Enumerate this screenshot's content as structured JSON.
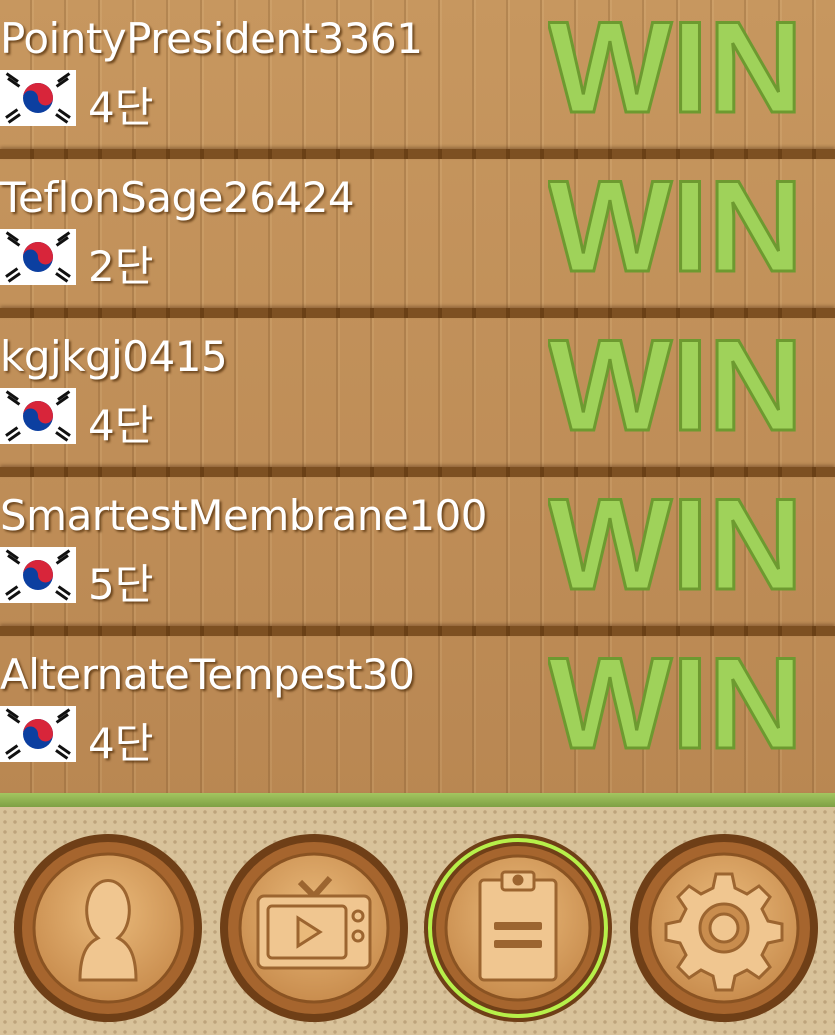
{
  "results": [
    {
      "name": "PointyPresident3361",
      "rank": "4단",
      "result": "WIN",
      "country": "south-korea-flag-icon"
    },
    {
      "name": "TeflonSage26424",
      "rank": "2단",
      "result": "WIN",
      "country": "south-korea-flag-icon"
    },
    {
      "name": "kgjkgj0415",
      "rank": "4단",
      "result": "WIN",
      "country": "south-korea-flag-icon"
    },
    {
      "name": "SmartestMembrane100",
      "rank": "5단",
      "result": "WIN",
      "country": "south-korea-flag-icon"
    },
    {
      "name": "AlternateTempest30",
      "rank": "4단",
      "result": "WIN",
      "country": "south-korea-flag-icon"
    }
  ],
  "nav": [
    {
      "icon": "profile-icon",
      "active": false
    },
    {
      "icon": "tv-video-icon",
      "active": false
    },
    {
      "icon": "clipboard-icon",
      "active": true
    },
    {
      "icon": "settings-gear-icon",
      "active": false
    }
  ],
  "colors": {
    "wood": "#b98752",
    "win_green": "#9fd25a",
    "active_ring": "#b7f04a"
  }
}
